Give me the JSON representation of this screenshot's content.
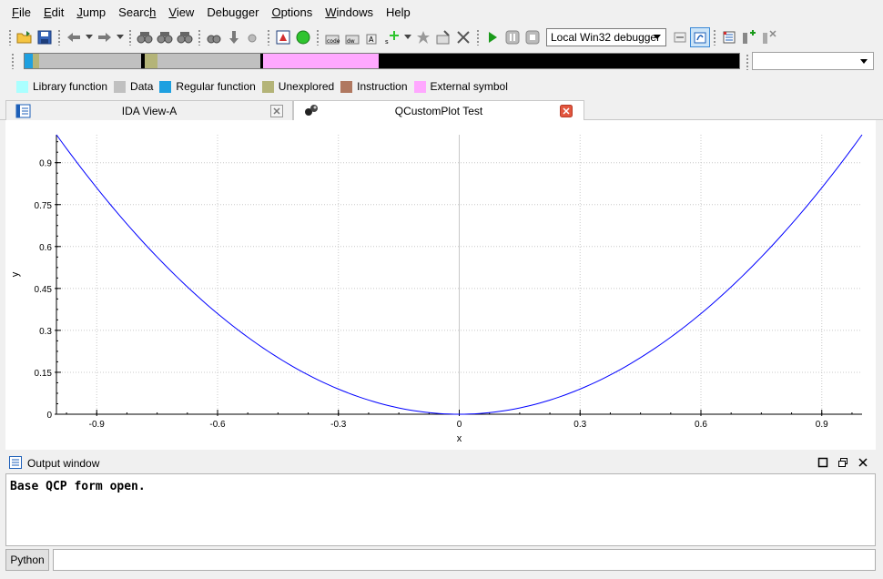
{
  "menu": [
    {
      "pre": "",
      "ul": "F",
      "post": "ile"
    },
    {
      "pre": "",
      "ul": "E",
      "post": "dit"
    },
    {
      "pre": "",
      "ul": "J",
      "post": "ump"
    },
    {
      "pre": "Searc",
      "ul": "h",
      "post": ""
    },
    {
      "pre": "",
      "ul": "V",
      "post": "iew"
    },
    {
      "pre": "Debugger",
      "ul": "",
      "post": ""
    },
    {
      "pre": "",
      "ul": "O",
      "post": "ptions"
    },
    {
      "pre": "",
      "ul": "W",
      "post": "indows"
    },
    {
      "pre": "Help",
      "ul": "",
      "post": ""
    }
  ],
  "toolbar": {
    "debugger_select": "Local Win32 debugger"
  },
  "navband": {
    "segments": [
      {
        "start": 0.0,
        "end": 0.012,
        "color": "#1ea0e0"
      },
      {
        "start": 0.012,
        "end": 0.02,
        "color": "#b4b478"
      },
      {
        "start": 0.02,
        "end": 0.163,
        "color": "#c0c0c0"
      },
      {
        "start": 0.163,
        "end": 0.168,
        "color": "#000000"
      },
      {
        "start": 0.168,
        "end": 0.186,
        "color": "#b4b478"
      },
      {
        "start": 0.186,
        "end": 0.33,
        "color": "#c0c0c0"
      },
      {
        "start": 0.33,
        "end": 0.334,
        "color": "#000000"
      },
      {
        "start": 0.334,
        "end": 0.495,
        "color": "#ffa8ff"
      },
      {
        "start": 0.495,
        "end": 1.0,
        "color": "#000000"
      }
    ]
  },
  "legend": [
    {
      "label": "Library function",
      "color": "#aaffff"
    },
    {
      "label": "Data",
      "color": "#c0c0c0"
    },
    {
      "label": "Regular function",
      "color": "#1ea0e0"
    },
    {
      "label": "Unexplored",
      "color": "#b4b478"
    },
    {
      "label": "Instruction",
      "color": "#b07860"
    },
    {
      "label": "External symbol",
      "color": "#ffa8ff"
    }
  ],
  "tabs": [
    {
      "label": "IDA View-A",
      "active": false
    },
    {
      "label": "QCustomPlot Test",
      "active": true
    }
  ],
  "chart_data": {
    "type": "line",
    "function": "y = x^2",
    "xlabel": "x",
    "ylabel": "y",
    "xlim": [
      -1,
      1
    ],
    "ylim": [
      0,
      1.0
    ],
    "xticks": [
      -0.9,
      -0.6,
      -0.3,
      0,
      0.3,
      0.6,
      0.9
    ],
    "xtick_labels": [
      "-0.9",
      "-0.6",
      "-0.3",
      "0",
      "0.3",
      "0.6",
      "0.9"
    ],
    "yticks": [
      0,
      0.15,
      0.3,
      0.45,
      0.6,
      0.75,
      0.9
    ],
    "ytick_labels": [
      "0",
      "0.15",
      "0.3",
      "0.45",
      "0.6",
      "0.75",
      "0.9"
    ],
    "grid": true,
    "series": [
      {
        "color": "#0000ff",
        "x": [
          -1.0,
          -0.9,
          -0.8,
          -0.7,
          -0.6,
          -0.5,
          -0.4,
          -0.3,
          -0.2,
          -0.1,
          0.0,
          0.1,
          0.2,
          0.3,
          0.4,
          0.5,
          0.6,
          0.7,
          0.8,
          0.9,
          1.0
        ],
        "y": [
          1.0,
          0.81,
          0.64,
          0.49,
          0.36,
          0.25,
          0.16,
          0.09,
          0.04,
          0.01,
          0.0,
          0.01,
          0.04,
          0.09,
          0.16,
          0.25,
          0.36,
          0.49,
          0.64,
          0.81,
          1.0
        ]
      }
    ]
  },
  "output": {
    "title": "Output window",
    "text": "Base QCP form open."
  },
  "cmd": {
    "lang_button": "Python",
    "value": ""
  }
}
